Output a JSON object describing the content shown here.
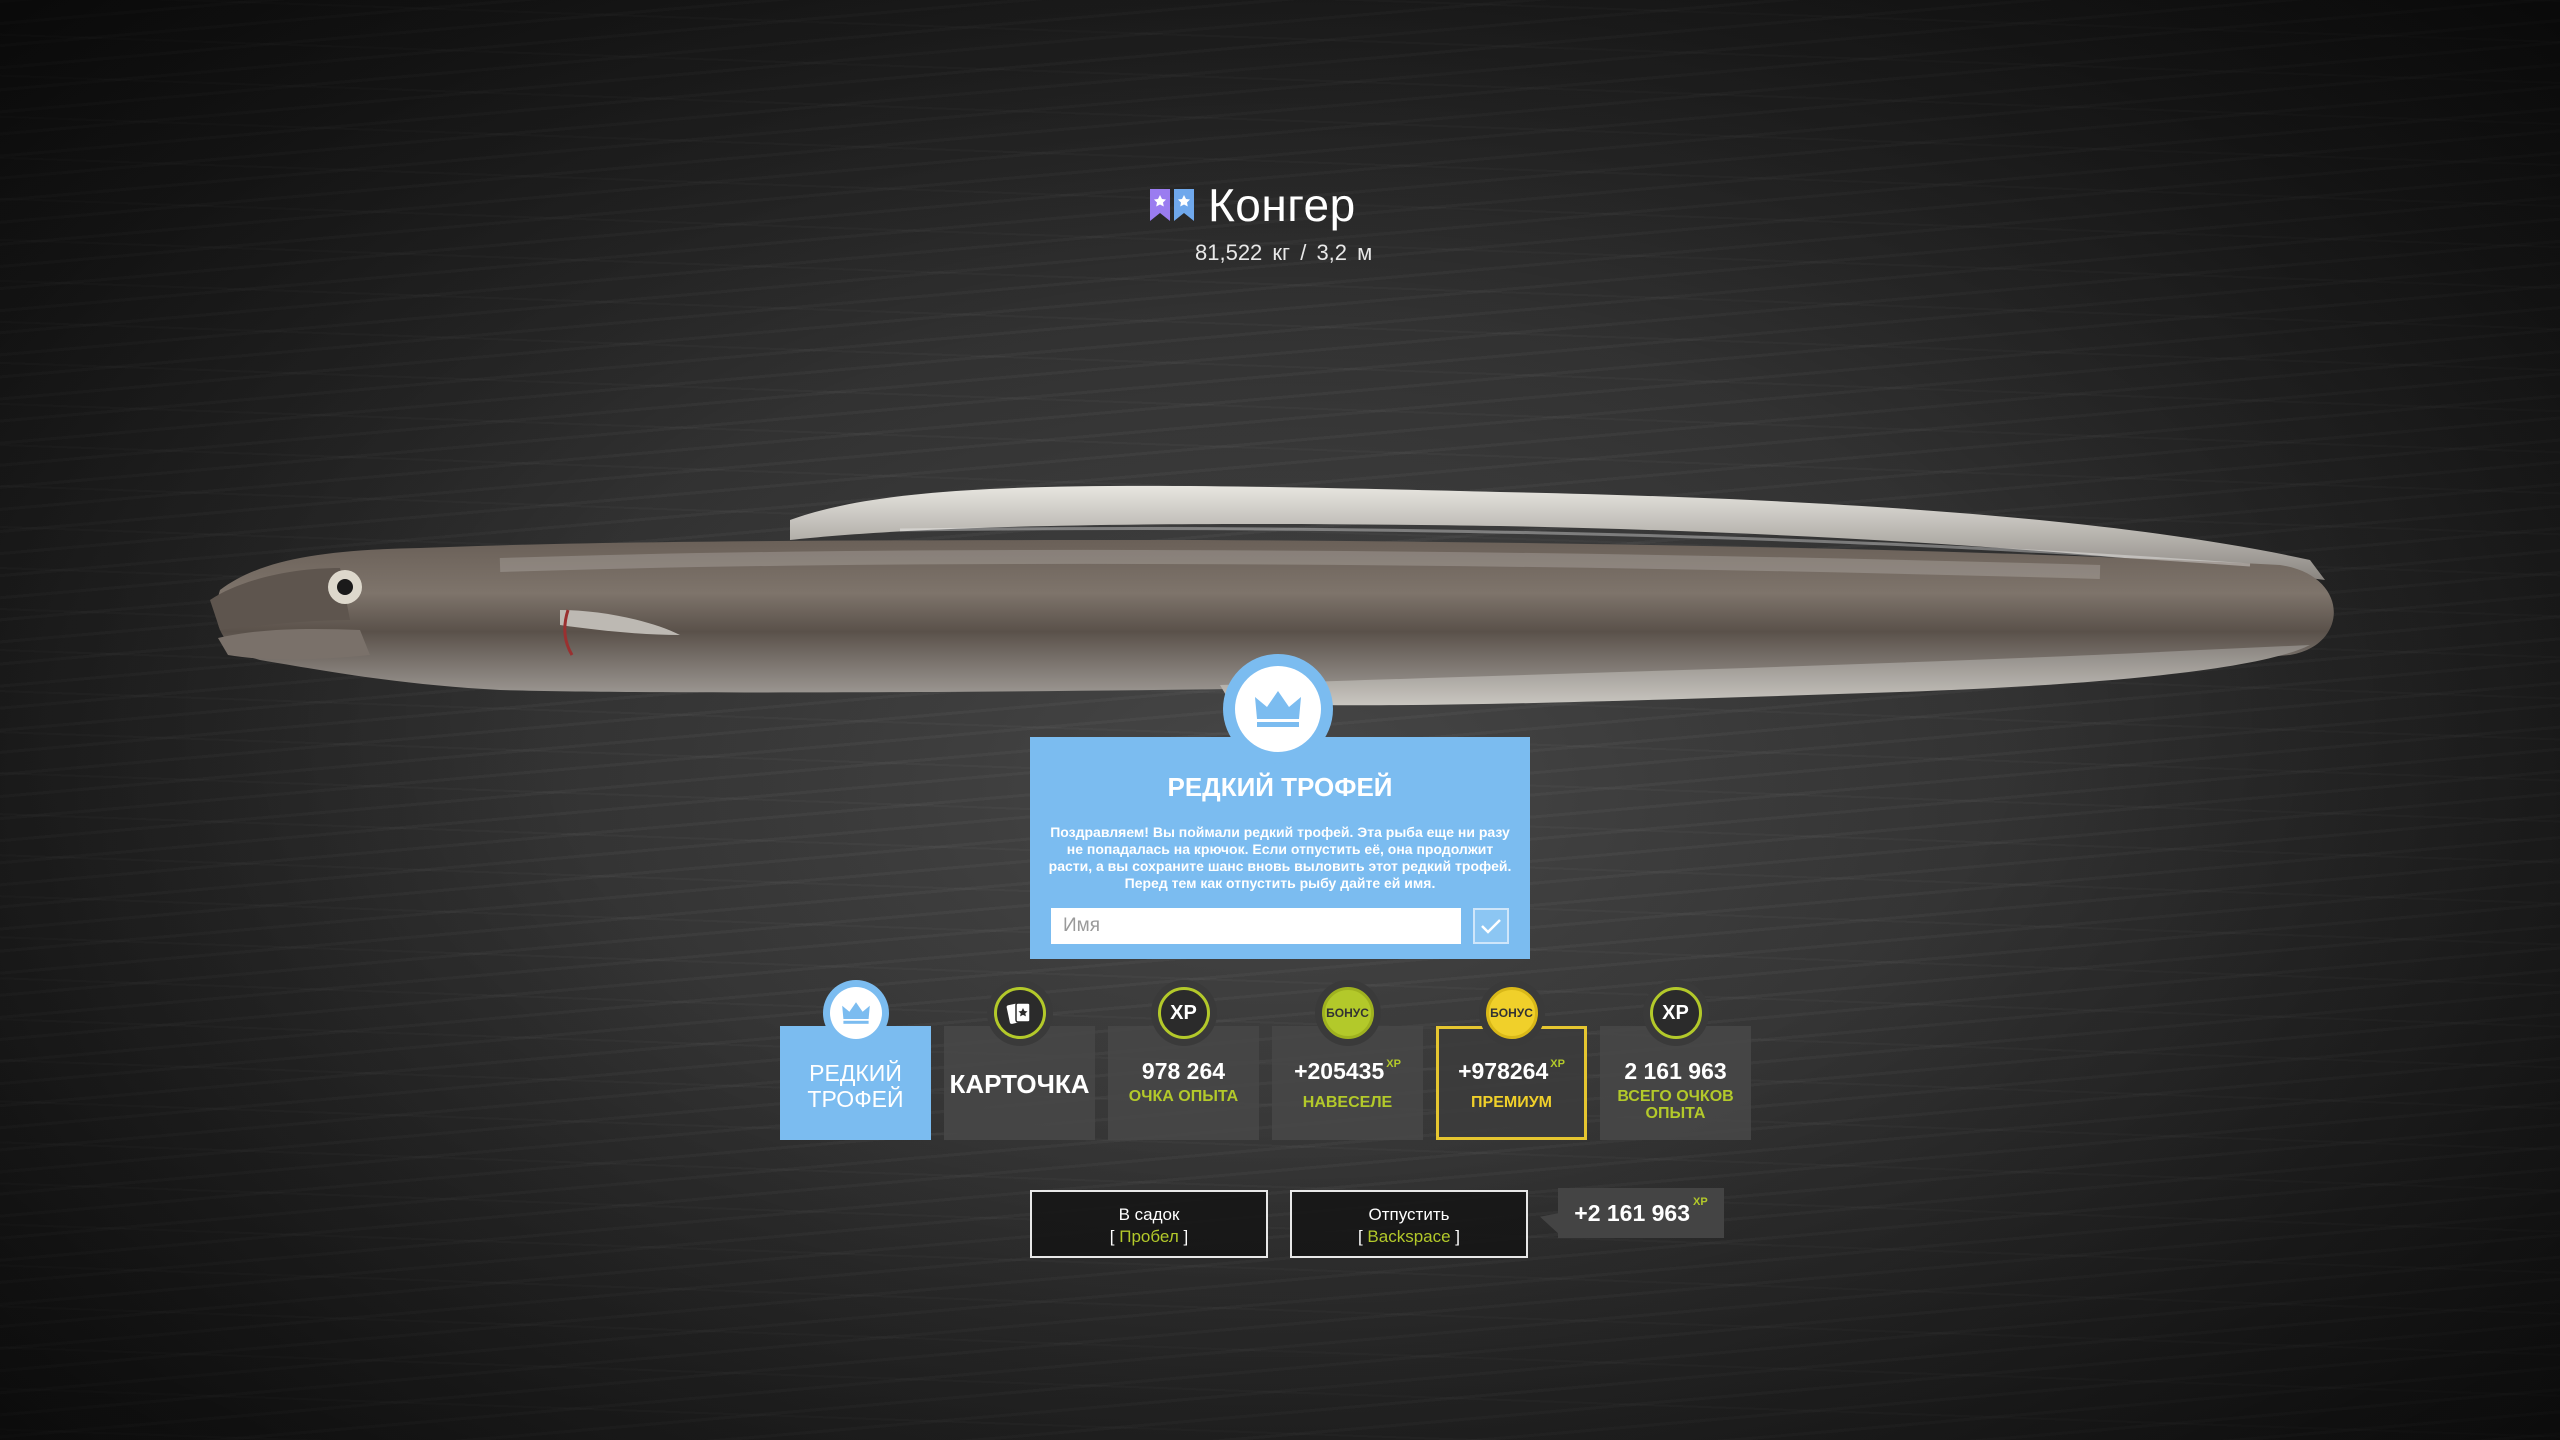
{
  "fish": {
    "name": "Конгер",
    "weight": "81,522 кг",
    "separator": "/",
    "length": "3,2 м"
  },
  "trophy_panel": {
    "title": "РЕДКИЙ ТРОФЕЙ",
    "text": "Поздравляем! Вы поймали редкий трофей. Эта рыба еще ни разу не попадалась на крючок. Если отпустить её, она продолжит расти, а вы сохраните шанс вновь выловить этот редкий трофей. Перед тем как отпустить рыбу дайте ей имя.",
    "name_placeholder": "Имя",
    "name_value": ""
  },
  "cards": {
    "rare_trophy": {
      "label": "РЕДКИЙ ТРОФЕЙ",
      "icon": "crown-icon"
    },
    "card": {
      "label": "КАРТОЧКА",
      "icon": "cards-icon"
    },
    "xp": {
      "icon_text": "XP",
      "value": "978 264",
      "label": "ОЧКА ОПЫТА"
    },
    "bonus_fun": {
      "icon_text": "БОНУС",
      "value": "+205435",
      "unit": "XP",
      "label": "НАВЕСЕЛЕ"
    },
    "bonus_premium": {
      "icon_text": "БОНУС",
      "value": "+978264",
      "unit": "XP",
      "label": "ПРЕМИУМ"
    },
    "total": {
      "icon_text": "XP",
      "value": "2 161 963",
      "label": "ВСЕГО ОЧКОВ ОПЫТА"
    }
  },
  "actions": {
    "keep": {
      "label": "В садок",
      "key": "Пробел"
    },
    "release": {
      "label": "Отпустить",
      "key": "Backspace"
    },
    "release_xp": {
      "value": "+2 161 963",
      "unit": "XP"
    }
  },
  "colors": {
    "accent_blue": "#7bbcf0",
    "xp_lime": "#b3c92a",
    "premium_gold": "#f0d02a",
    "rare_purple": "#9a7cf0"
  }
}
